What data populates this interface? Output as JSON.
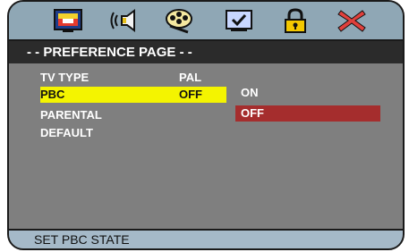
{
  "toolbar": {
    "icons": [
      {
        "name": "general-setup-icon",
        "active": true
      },
      {
        "name": "audio-setup-icon",
        "active": false
      },
      {
        "name": "video-setup-icon",
        "active": false
      },
      {
        "name": "preference-icon",
        "active": false
      },
      {
        "name": "password-lock-icon",
        "active": false
      },
      {
        "name": "exit-icon",
        "active": false
      }
    ]
  },
  "title": "- - PREFERENCE PAGE - -",
  "menu": [
    {
      "label": "TV TYPE",
      "value": "PAL",
      "selected": false
    },
    {
      "label": "PBC",
      "value": "OFF",
      "selected": true
    },
    {
      "label": "PARENTAL",
      "value": "",
      "selected": false
    },
    {
      "label": "DEFAULT",
      "value": "",
      "selected": false
    }
  ],
  "options": [
    {
      "label": "ON",
      "highlighted": false
    },
    {
      "label": "OFF",
      "highlighted": true
    }
  ],
  "status": "SET PBC STATE",
  "colors": {
    "panel_bg": "#7f7f7f",
    "title_bg": "#2b2b2b",
    "selected_row": "#f4f400",
    "highlighted_option": "#a52d2d",
    "status_bg": "#a5b9c8",
    "toolbar_bg": "#8fa7b5"
  }
}
